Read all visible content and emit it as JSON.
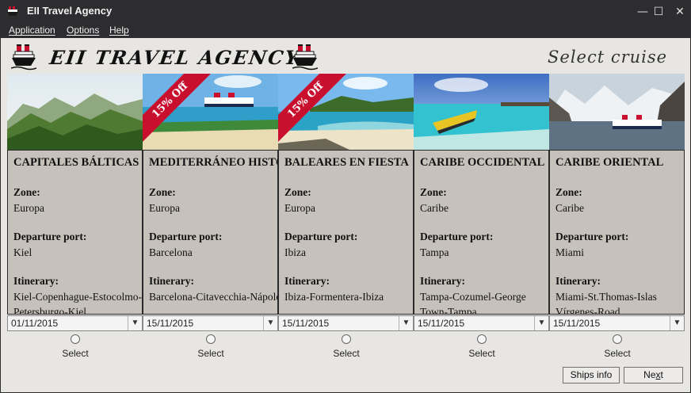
{
  "window": {
    "title": "EII Travel Agency",
    "minimize_glyph": "—",
    "maximize_glyph": "☐",
    "close_glyph": "✕"
  },
  "menu": [
    {
      "label": "Application"
    },
    {
      "label": "Options"
    },
    {
      "label": "Help"
    }
  ],
  "header": {
    "brand": "EII TRAVEL AGENCY",
    "title": "Select cruise",
    "logo_icon": "cruise-ship-icon"
  },
  "labels": {
    "zone": "Zone:",
    "departure": "Departure port:",
    "itinerary": "Itinerary:",
    "select": "Select"
  },
  "cruises": [
    {
      "name": "CAPITALES BÁLTICAS",
      "zone": "Europa",
      "port": "Kiel",
      "itinerary": "Kiel-Copenhague-Estocolmo-",
      "itinerary_cont": "Petersburgo-Kiel",
      "date": "01/11/2015",
      "offer": "",
      "scene": "mountains"
    },
    {
      "name": "MEDITERRÁNEO HISTÓRICO",
      "zone": "Europa",
      "port": "Barcelona",
      "itinerary": "Barcelona-Citavecchia-Nápoles",
      "itinerary_cont": "",
      "date": "15/11/2015",
      "offer": "15% Off",
      "scene": "ship-coast"
    },
    {
      "name": "BALEARES EN FIESTA",
      "zone": "Europa",
      "port": "Ibiza",
      "itinerary": "Ibiza-Formentera-Ibiza",
      "itinerary_cont": "",
      "date": "15/11/2015",
      "offer": "15% Off",
      "scene": "beach"
    },
    {
      "name": "CARIBE OCCIDENTAL",
      "zone": "Caribe",
      "port": "Tampa",
      "itinerary": "Tampa-Cozumel-George",
      "itinerary_cont": "Town-Tampa",
      "date": "15/11/2015",
      "offer": "",
      "scene": "boat-lagoon"
    },
    {
      "name": "CARIBE ORIENTAL",
      "zone": "Caribe",
      "port": "Miami",
      "itinerary": "Miami-St.Thomas-Islas",
      "itinerary_cont": "Vírgenes-Road",
      "date": "15/11/2015",
      "offer": "",
      "scene": "fjord"
    }
  ],
  "buttons": {
    "ships_info": "Ships info",
    "next_prefix": "Ne",
    "next_underlined": "x",
    "next_suffix": "t"
  },
  "colors": {
    "titlebar": "#2d2d30",
    "client_bg": "#e8e6e3",
    "card_body": "#c6c2bb",
    "offer_ribbon": "#c8102e"
  }
}
